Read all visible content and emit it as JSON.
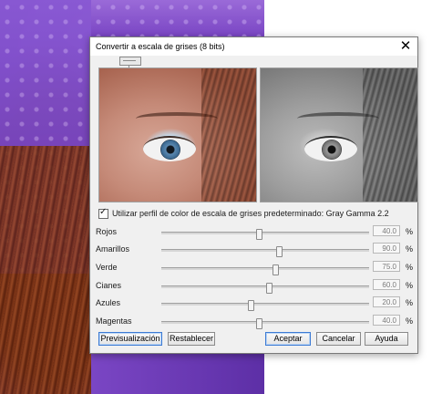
{
  "dialog": {
    "title": "Convertir a escala de grises (8 bits)",
    "close_glyph": "✕"
  },
  "options": {
    "use_gray_profile_checked": true,
    "use_gray_profile_label": "Utilizar perfil de color de escala de grises predeterminado: Gray Gamma 2.2"
  },
  "sliders": [
    {
      "label": "Rojos",
      "value": "40.0",
      "unit": "%",
      "position": 0.47
    },
    {
      "label": "Amarillos",
      "value": "90.0",
      "unit": "%",
      "position": 0.57
    },
    {
      "label": "Verde",
      "value": "75.0",
      "unit": "%",
      "position": 0.55
    },
    {
      "label": "Cianes",
      "value": "60.0",
      "unit": "%",
      "position": 0.52
    },
    {
      "label": "Azules",
      "value": "20.0",
      "unit": "%",
      "position": 0.43
    },
    {
      "label": "Magentas",
      "value": "40.0",
      "unit": "%",
      "position": 0.47
    }
  ],
  "buttons": {
    "preview": "Previsualización",
    "reset": "Restablecer",
    "ok": "Aceptar",
    "cancel": "Cancelar",
    "help": "Ayuda"
  },
  "colors": {
    "accent_border": "#3d7bd4",
    "background_veil": "#7a46c4"
  }
}
